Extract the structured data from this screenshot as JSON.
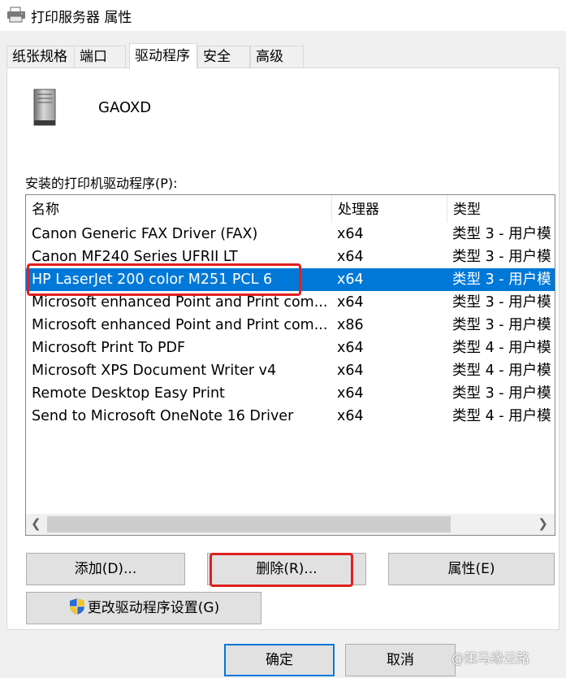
{
  "window": {
    "title": "打印服务器 属性",
    "icon": "printer-icon"
  },
  "tabs": [
    {
      "label": "纸张规格"
    },
    {
      "label": "端口"
    },
    {
      "label": "驱动程序"
    },
    {
      "label": "安全"
    },
    {
      "label": "高级"
    }
  ],
  "active_tab": "驱动程序",
  "server": {
    "name": "GAOXD",
    "icon": "server-icon"
  },
  "drivers_list": {
    "label": "安装的打印机驱动程序(P):",
    "columns": [
      "名称",
      "处理器",
      "类型"
    ],
    "rows": [
      {
        "name": "Canon Generic FAX Driver (FAX)",
        "processor": "x64",
        "type": "类型 3 - 用户模"
      },
      {
        "name": "Canon MF240 Series UFRII LT",
        "processor": "x64",
        "type": "类型 3 - 用户模"
      },
      {
        "name": "HP LaserJet 200 color M251 PCL 6",
        "processor": "x64",
        "type": "类型 3 - 用户模"
      },
      {
        "name": "Microsoft enhanced Point and Print com...",
        "processor": "x64",
        "type": "类型 3 - 用户模"
      },
      {
        "name": "Microsoft enhanced Point and Print com...",
        "processor": "x86",
        "type": "类型 3 - 用户模"
      },
      {
        "name": "Microsoft Print To PDF",
        "processor": "x64",
        "type": "类型 4 - 用户模"
      },
      {
        "name": "Microsoft XPS Document Writer v4",
        "processor": "x64",
        "type": "类型 4 - 用户模"
      },
      {
        "name": "Remote Desktop Easy Print",
        "processor": "x64",
        "type": "类型 3 - 用户模"
      },
      {
        "name": "Send to Microsoft OneNote 16 Driver",
        "processor": "x64",
        "type": "类型 4 - 用户模"
      }
    ],
    "selected_index": 2
  },
  "buttons": {
    "add": "添加(D)...",
    "remove": "删除(R)...",
    "properties": "属性(E)",
    "change_settings": "更改驱动程序设置(G)",
    "ok": "确定",
    "cancel": "取消"
  },
  "watermark": "@策马缘云路",
  "colors": {
    "selection": "#0078d7",
    "annotation": "#e02020",
    "panel": "#ffffff",
    "window_bg": "#f0f0f0"
  }
}
